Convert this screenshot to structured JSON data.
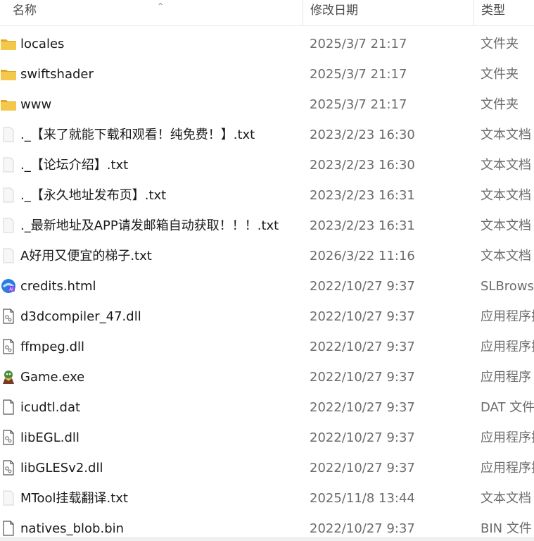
{
  "columns": {
    "name": "名称",
    "date": "修改日期",
    "type": "类型"
  },
  "files": [
    {
      "name": "locales",
      "date": "2025/3/7 21:17",
      "type": "文件夹",
      "icon": "folder-icon"
    },
    {
      "name": "swiftshader",
      "date": "2025/3/7 21:17",
      "type": "文件夹",
      "icon": "folder-icon"
    },
    {
      "name": "www",
      "date": "2025/3/7 21:17",
      "type": "文件夹",
      "icon": "folder-icon"
    },
    {
      "name": "._【来了就能下载和观看！纯免费！】.txt",
      "date": "2023/2/23 16:30",
      "type": "文本文档",
      "icon": "text-file-icon"
    },
    {
      "name": "._【论坛介绍】.txt",
      "date": "2023/2/23 16:30",
      "type": "文本文档",
      "icon": "text-file-icon"
    },
    {
      "name": "._【永久地址发布页】.txt",
      "date": "2023/2/23 16:31",
      "type": "文本文档",
      "icon": "text-file-icon"
    },
    {
      "name": "._最新地址及APP请发邮箱自动获取！！！.txt",
      "date": "2023/2/23 16:31",
      "type": "文本文档",
      "icon": "text-file-icon"
    },
    {
      "name": "A好用又便宜的梯子.txt",
      "date": "2026/3/22 11:16",
      "type": "文本文档",
      "icon": "text-file-icon"
    },
    {
      "name": "credits.html",
      "date": "2022/10/27 9:37",
      "type": "SLBrowse",
      "icon": "browser-html-icon"
    },
    {
      "name": "d3dcompiler_47.dll",
      "date": "2022/10/27 9:37",
      "type": "应用程序扩",
      "icon": "dll-file-icon"
    },
    {
      "name": "ffmpeg.dll",
      "date": "2022/10/27 9:37",
      "type": "应用程序扩",
      "icon": "dll-file-icon"
    },
    {
      "name": "Game.exe",
      "date": "2022/10/27 9:37",
      "type": "应用程序",
      "icon": "game-exe-icon"
    },
    {
      "name": "icudtl.dat",
      "date": "2022/10/27 9:37",
      "type": "DAT 文件",
      "icon": "blank-file-icon"
    },
    {
      "name": "libEGL.dll",
      "date": "2022/10/27 9:37",
      "type": "应用程序扩",
      "icon": "dll-file-icon"
    },
    {
      "name": "libGLESv2.dll",
      "date": "2022/10/27 9:37",
      "type": "应用程序扩",
      "icon": "dll-file-icon"
    },
    {
      "name": "MTool挂载翻译.txt",
      "date": "2025/11/8 13:44",
      "type": "文本文档",
      "icon": "text-file-icon"
    },
    {
      "name": "natives_blob.bin",
      "date": "2022/10/27 9:37",
      "type": "BIN 文件",
      "icon": "blank-file-icon"
    }
  ],
  "colors": {
    "folder": "#f4c84a",
    "folder_dark": "#e0a92a",
    "text_primary": "#1a1a1a",
    "text_secondary": "#6b6b6b"
  }
}
